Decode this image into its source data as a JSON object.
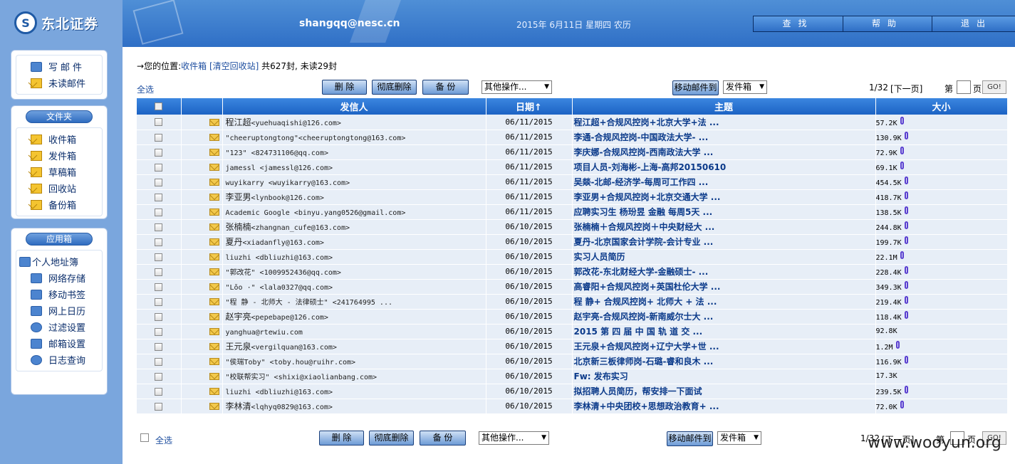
{
  "app": {
    "logo_text": "东北证券",
    "user": "shangqq@nesc.cn",
    "date": "2015年 6月11日 星期四 农历",
    "topnav": [
      "查找",
      "帮助",
      "退出"
    ]
  },
  "sidebar": {
    "compose": "写邮件",
    "unread": "未读邮件",
    "folders_title": "文件夹",
    "folders": [
      "收件箱",
      "发件箱",
      "草稿箱",
      "回收站",
      "备份箱"
    ],
    "apps_title": "应用箱",
    "apps": [
      "个人地址簿",
      "网络存储",
      "移动书签",
      "网上日历",
      "过滤设置",
      "邮箱设置",
      "日志查询"
    ]
  },
  "crumb": {
    "arrow": "→",
    "prefix": "您的位置:",
    "folder": "收件箱",
    "clear": "[清空回收站]",
    "counts": "共627封, 未读29封"
  },
  "toolbar": {
    "select_all": "全选",
    "delete": "删 除",
    "purge": "彻底删除",
    "backup": "备 份",
    "other_ops": "其他操作...",
    "move_to": "移动邮件到",
    "move_target": "发件箱",
    "page_info": "1/32",
    "next_page": "[下一页]",
    "page_prefix": "第",
    "page_suffix": "页",
    "go": "GO!"
  },
  "table": {
    "headers": {
      "from": "发信人",
      "date": "日期",
      "date_sort": "↑",
      "subject": "主题",
      "size": "大小"
    },
    "rows": [
      {
        "from_name": "程江超",
        "from_addr": "<yuehuaqishi@126.com>",
        "date": "06/11/2015",
        "subject": "程江超+合规风控岗+北京大学+法 ...",
        "size": "57.2K",
        "attach": true
      },
      {
        "from_name": "",
        "from_addr": "\"cheeruptongtong\"<cheeruptongtong@163.com>",
        "date": "06/11/2015",
        "subject": "李通-合规风控岗-中国政法大学- ...",
        "size": "130.9K",
        "attach": true
      },
      {
        "from_name": "",
        "from_addr": "\"123\" <824731106@qq.com>",
        "date": "06/11/2015",
        "subject": "李庆娜-合规风控岗-西南政法大学 ...",
        "size": "72.9K",
        "attach": true
      },
      {
        "from_name": "",
        "from_addr": "jamessl <jamessl@126.com>",
        "date": "06/11/2015",
        "subject": "项目人员-刘海彬-上海-高邦20150610",
        "size": "69.1K",
        "attach": true
      },
      {
        "from_name": "",
        "from_addr": "wuyikarry <wuyikarry@163.com>",
        "date": "06/11/2015",
        "subject": "吴燚-北邮-经济学-每周可工作四 ...",
        "size": "454.5K",
        "attach": true
      },
      {
        "from_name": "李亚男",
        "from_addr": "<lynbook@126.com>",
        "date": "06/11/2015",
        "subject": "李亚男+合规风控岗+北京交通大学 ...",
        "size": "418.7K",
        "attach": true
      },
      {
        "from_name": "",
        "from_addr": "Academic Google <binyu.yang0526@gmail.com>",
        "date": "06/11/2015",
        "subject": "应聘实习生 杨玢昱 金融 每周5天 ...",
        "size": "138.5K",
        "attach": true
      },
      {
        "from_name": "张楠楠",
        "from_addr": "<zhangnan_cufe@163.com>",
        "date": "06/10/2015",
        "subject": "张楠楠＋合规风控岗＋中央财经大 ...",
        "size": "244.8K",
        "attach": true
      },
      {
        "from_name": "夏丹",
        "from_addr": "<xiadanfly@163.com>",
        "date": "06/10/2015",
        "subject": "夏丹-北京国家会计学院-会计专业 ...",
        "size": "199.7K",
        "attach": true
      },
      {
        "from_name": "",
        "from_addr": "liuzhi <dbliuzhi@163.com>",
        "date": "06/10/2015",
        "subject": "实习人员简历",
        "size": "22.1M",
        "attach": true
      },
      {
        "from_name": "",
        "from_addr": "\"郭改花\" <1009952436@qq.com>",
        "date": "06/10/2015",
        "subject": "郭改花-东北财经大学-金融硕士- ...",
        "size": "228.4K",
        "attach": true
      },
      {
        "from_name": "",
        "from_addr": "\"Lǒo ·\" <lala0327@qq.com>",
        "date": "06/10/2015",
        "subject": "高睿阳+合规风控岗+英国杜伦大学 ...",
        "size": "349.3K",
        "attach": true
      },
      {
        "from_name": "",
        "from_addr": "\"程 静 - 北师大 - 法律硕士\" <241764995 ...",
        "date": "06/10/2015",
        "subject": "程 静+ 合规风控岗+ 北师大 + 法 ...",
        "size": "219.4K",
        "attach": true
      },
      {
        "from_name": "赵宇亮",
        "from_addr": "<pepebape@126.com>",
        "date": "06/10/2015",
        "subject": "赵宇亮-合规风控岗-新南威尔士大 ...",
        "size": "118.4K",
        "attach": true
      },
      {
        "from_name": "",
        "from_addr": "yanghua@rtewiu.com",
        "date": "06/10/2015",
        "subject": "2015 第 四 届 中 国 轨 道 交  ...",
        "size": "92.8K",
        "attach": false
      },
      {
        "from_name": "王元泉",
        "from_addr": "<vergilquan@163.com>",
        "date": "06/10/2015",
        "subject": "王元泉+合规风控岗+辽宁大学+世 ...",
        "size": "1.2M",
        "attach": true
      },
      {
        "from_name": "",
        "from_addr": "\"侯瑞Toby\" <toby.hou@ruihr.com>",
        "date": "06/10/2015",
        "subject": "北京新三板律师岗-石璐-睿和良木 ...",
        "size": "116.9K",
        "attach": true
      },
      {
        "from_name": "",
        "from_addr": "\"校联帮实习\" <shixi@xiaolianbang.com>",
        "date": "06/10/2015",
        "subject": "Fw: 发布实习",
        "size": "17.3K",
        "attach": false
      },
      {
        "from_name": "",
        "from_addr": "liuzhi <dbliuzhi@163.com>",
        "date": "06/10/2015",
        "subject": "拟招聘人员简历，帮安排一下面试",
        "size": "239.5K",
        "attach": true
      },
      {
        "from_name": "李林清",
        "from_addr": "<lqhyq0829@163.com>",
        "date": "06/10/2015",
        "subject": "李林清+中央团校+思想政治教育+ ...",
        "size": "72.0K",
        "attach": true
      }
    ]
  },
  "watermark": "www.wooyun.org"
}
